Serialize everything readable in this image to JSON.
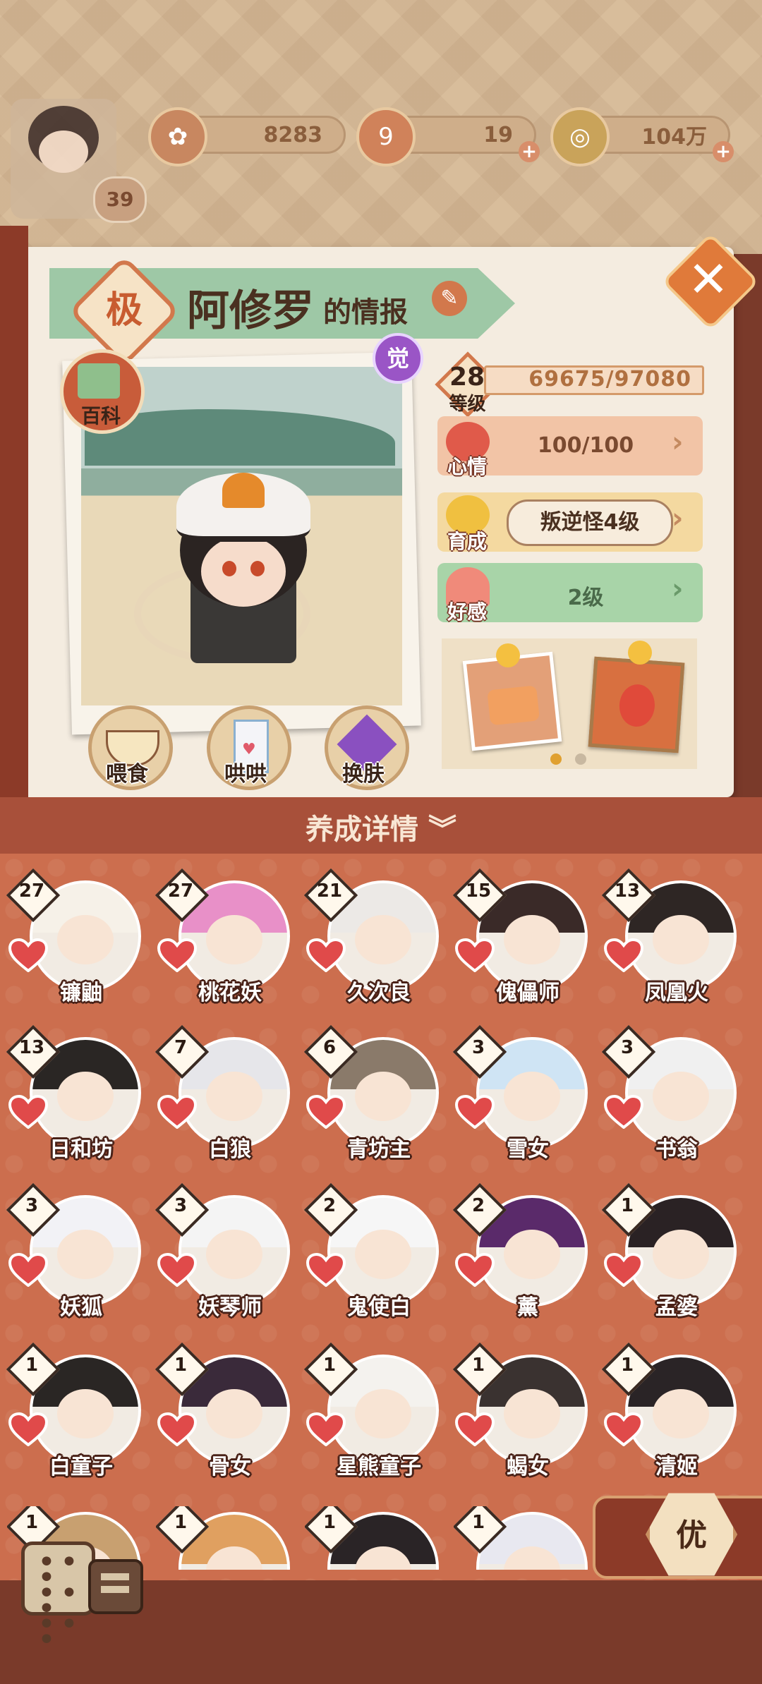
{
  "header": {
    "player_level": "39",
    "currency": [
      {
        "value": "8283",
        "icon": "flower-coin-icon",
        "has_plus": false
      },
      {
        "value": "19",
        "icon": "jade-icon",
        "has_plus": true
      },
      {
        "value": "104万",
        "icon": "copper-coin-icon",
        "has_plus": true
      }
    ]
  },
  "profile": {
    "rank": "极",
    "name": "阿修罗",
    "title_suffix": "的情报",
    "wiki_label": "百科",
    "awaken_badge": "觉",
    "actions": [
      {
        "label": "喂食",
        "icon": "food-bowl-icon"
      },
      {
        "label": "哄哄",
        "icon": "milk-carton-icon"
      },
      {
        "label": "换肤",
        "icon": "skin-crystal-icon"
      }
    ]
  },
  "stats": {
    "level": "28",
    "level_label": "等级",
    "exp": "69675/97080",
    "mood_label": "心情",
    "mood_value": "100/100",
    "train_label": "育成",
    "train_value": "叛逆怪4级",
    "favor_label": "好感",
    "favor_value": "2级"
  },
  "details_label": "养成详情",
  "characters": [
    {
      "name": "镰鼬",
      "level": "27",
      "hair": "#f6f1e8"
    },
    {
      "name": "桃花妖",
      "level": "27",
      "hair": "#e890c8"
    },
    {
      "name": "久次良",
      "level": "21",
      "hair": "#ece9e6"
    },
    {
      "name": "傀儡师",
      "level": "15",
      "hair": "#3a2a28"
    },
    {
      "name": "凤凰火",
      "level": "13",
      "hair": "#2e2624"
    },
    {
      "name": "日和坊",
      "level": "13",
      "hair": "#2a2624"
    },
    {
      "name": "白狼",
      "level": "7",
      "hair": "#e6e6ea"
    },
    {
      "name": "青坊主",
      "level": "6",
      "hair": "#8a7a6a"
    },
    {
      "name": "雪女",
      "level": "3",
      "hair": "#cfe4f4"
    },
    {
      "name": "书翁",
      "level": "3",
      "hair": "#f0f0f0"
    },
    {
      "name": "妖狐",
      "level": "3",
      "hair": "#f2f2f6"
    },
    {
      "name": "妖琴师",
      "level": "3",
      "hair": "#f4f4f4"
    },
    {
      "name": "鬼使白",
      "level": "2",
      "hair": "#f6f6f6"
    },
    {
      "name": "薰",
      "level": "2",
      "hair": "#5a2a6a"
    },
    {
      "name": "孟婆",
      "level": "1",
      "hair": "#2a2224"
    },
    {
      "name": "白童子",
      "level": "1",
      "hair": "#2a2624"
    },
    {
      "name": "骨女",
      "level": "1",
      "hair": "#3a2a3a"
    },
    {
      "name": "星熊童子",
      "level": "1",
      "hair": "#f4f2ee"
    },
    {
      "name": "蝎女",
      "level": "1",
      "hair": "#3a3230"
    },
    {
      "name": "清姬",
      "level": "1",
      "hair": "#2a2426"
    },
    {
      "name": "",
      "level": "1",
      "hair": "#c8a070"
    },
    {
      "name": "",
      "level": "1",
      "hair": "#e0a060"
    },
    {
      "name": "",
      "level": "1",
      "hair": "#2a2426"
    },
    {
      "name": "",
      "level": "1",
      "hair": "#e8e8f0"
    }
  ],
  "bottom": {
    "you_label": "优"
  },
  "colors": {
    "accent": "#c85c3a",
    "panel": "#f4ece0",
    "grid_bg": "#cc6e4e",
    "mood_bar": "#f2c4a6",
    "train_bar": "#f4d9a0",
    "favor_bar": "#a8d4a8"
  }
}
